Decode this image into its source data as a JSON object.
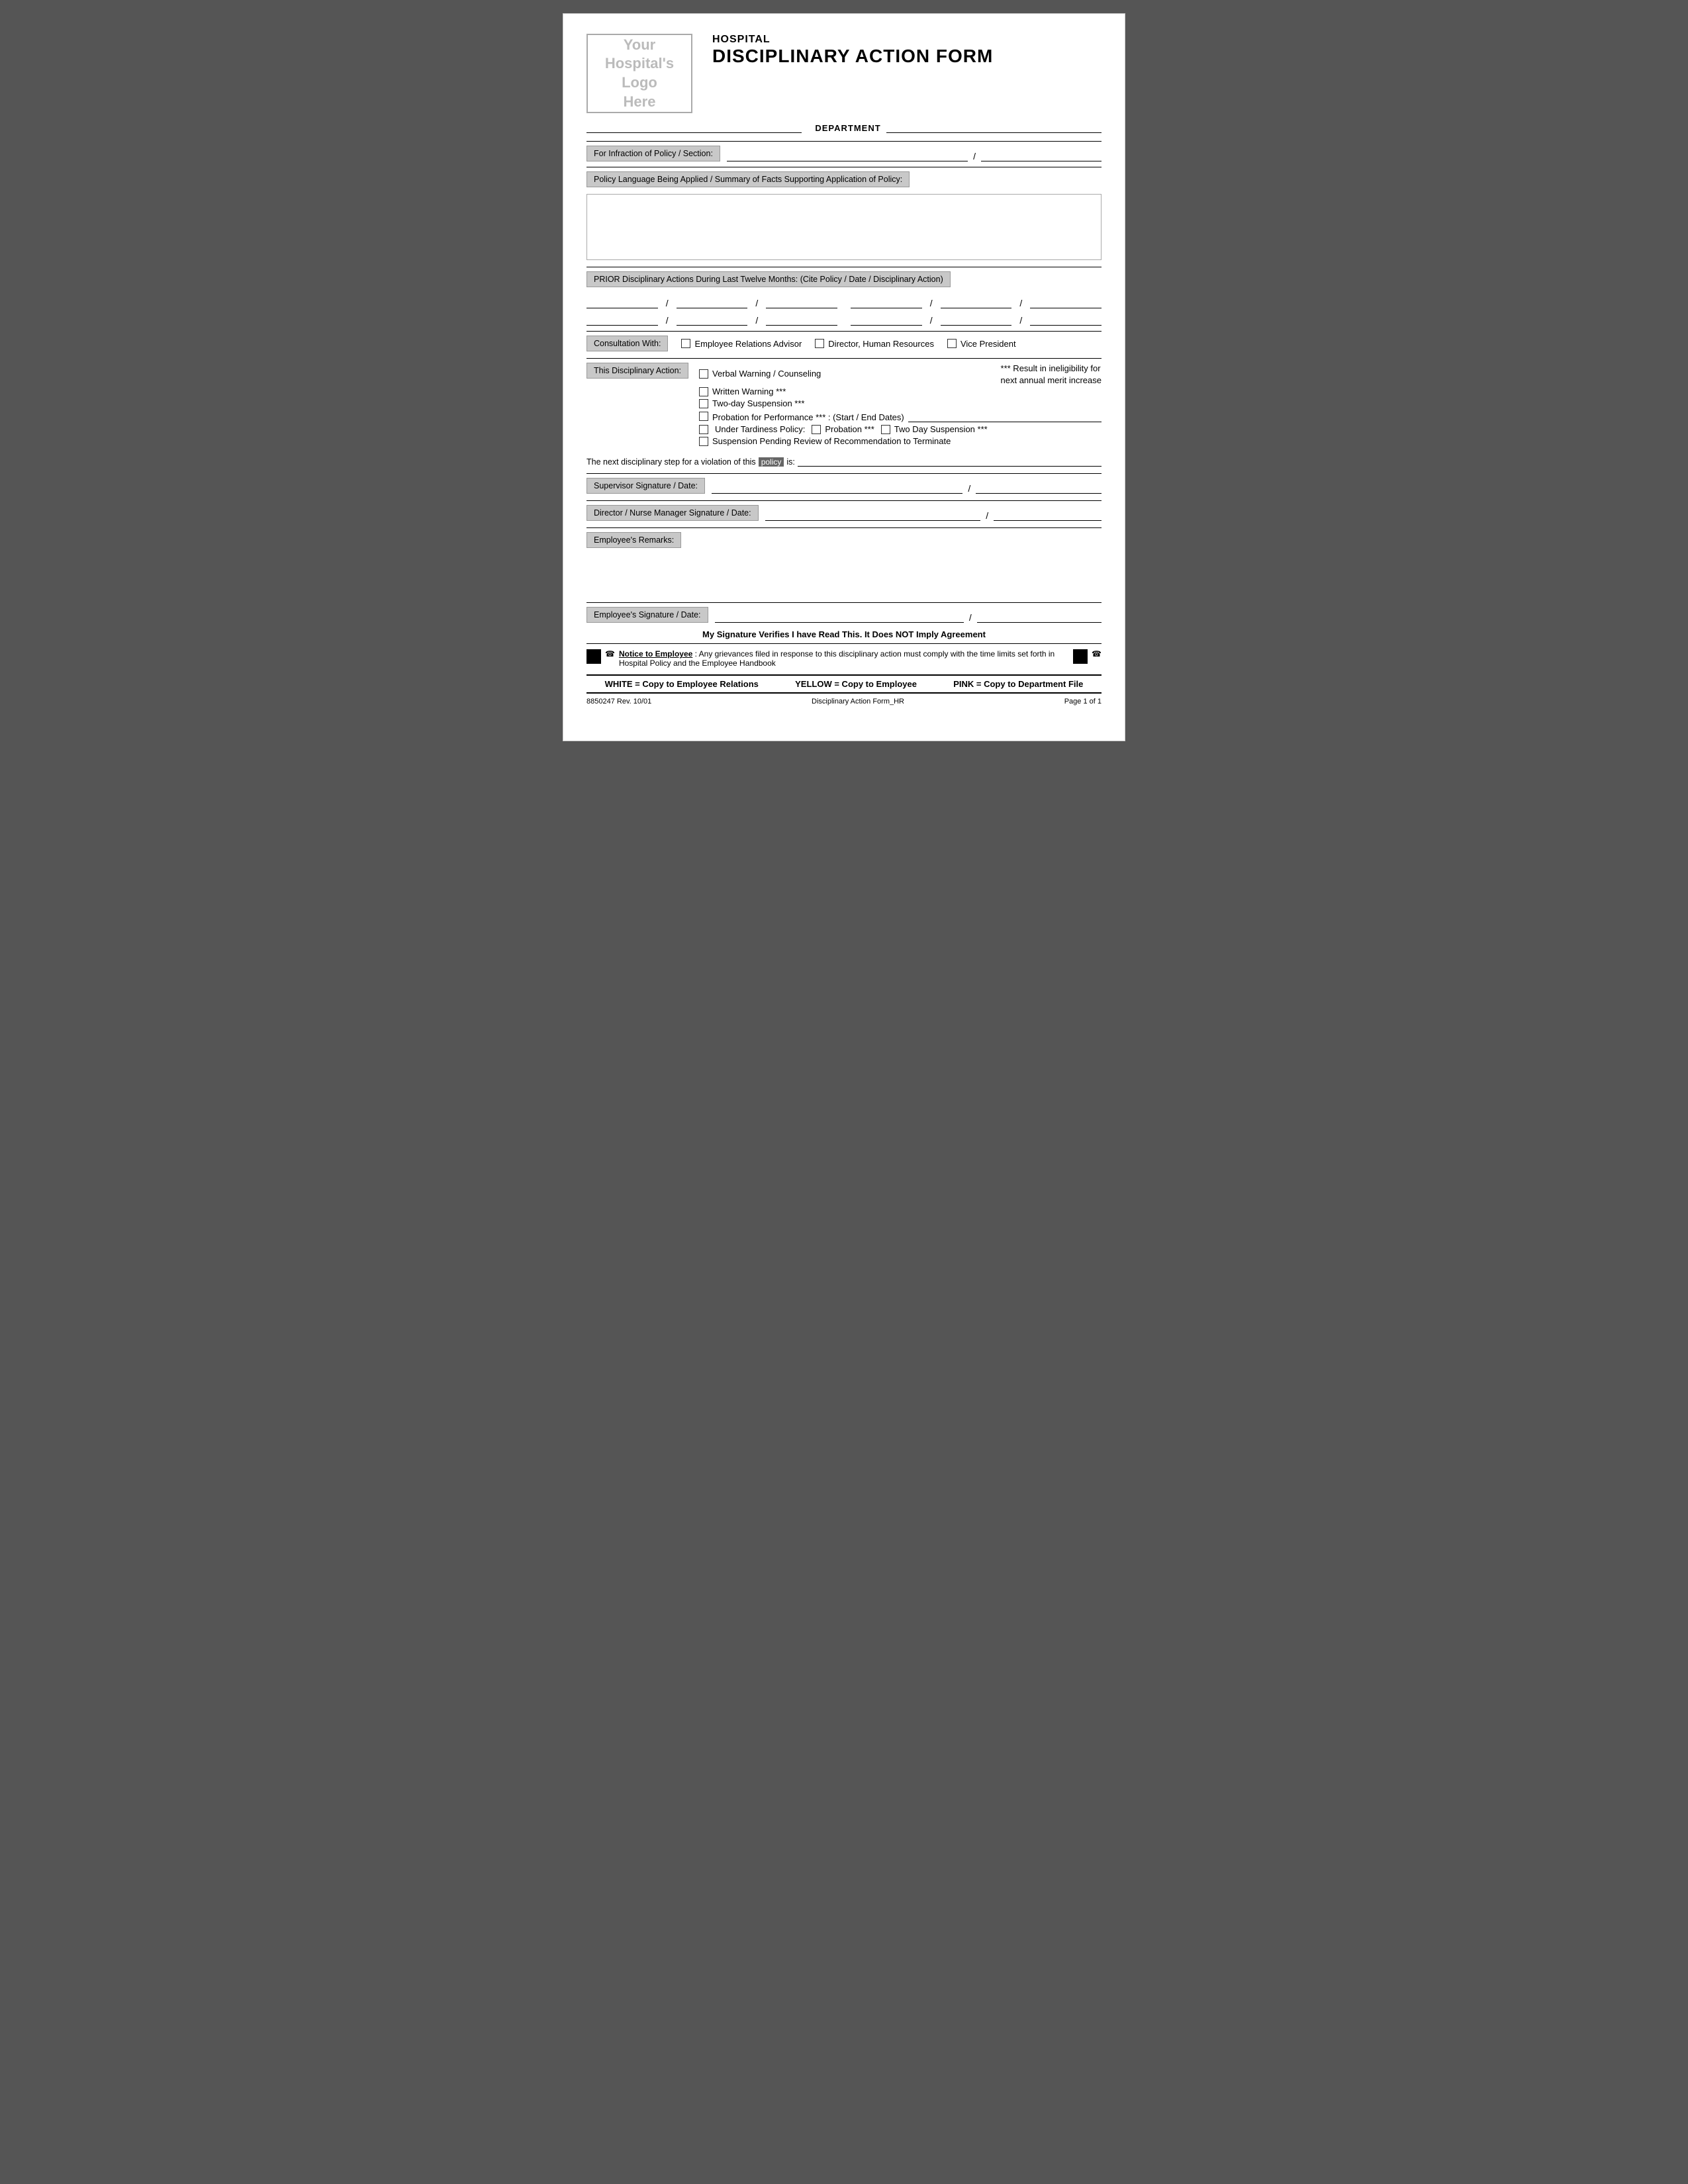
{
  "page": {
    "logo_text": "Your\nHospital's\nLogo\nHere",
    "hospital_label": "HOSPITAL",
    "main_title": "DISCIPLINARY ACTION FORM",
    "dept_label": "DEPARTMENT",
    "infraction_label": "For Infraction of Policy / Section:",
    "policy_label": "Policy Language Being Applied / Summary of Facts Supporting Application of Policy:",
    "prior_label": "PRIOR Disciplinary Actions During Last Twelve Months:   (Cite Policy / Date / Disciplinary Action)",
    "consult_label": "Consultation With:",
    "consult_options": [
      "Employee Relations Advisor",
      "Director, Human Resources",
      "Vice President"
    ],
    "disc_label": "This Disciplinary Action:",
    "disc_options": [
      "Verbal Warning / Counseling",
      "Written Warning ***",
      "Two-day Suspension ***",
      "Probation for Performance *** :  (Start / End Dates)",
      "Under Tardiness Policy:",
      "Suspension Pending Review of Recommendation to Terminate"
    ],
    "tardiness_sub": [
      "Probation ***",
      "Two Day Suspension ***"
    ],
    "result_note_line1": "*** Result in ineligibility for",
    "result_note_line2": "next annual merit increase",
    "next_step_prefix": "The next disciplinary step for a violation of this",
    "next_step_policy": "policy",
    "next_step_suffix": "is:",
    "supervisor_label": "Supervisor Signature / Date:",
    "director_label": "Director / Nurse Manager Signature / Date:",
    "remarks_label": "Employee's Remarks:",
    "emp_sig_label": "Employee's Signature / Date:",
    "sig_verify": "My Signature Verifies I have Read This.  It Does NOT Imply Agreement",
    "notice_label": "Notice to Employee",
    "notice_text": ": Any grievances filed in response to this disciplinary action must comply with the time limits set forth in Hospital Policy and the Employee Handbook",
    "copy_footer": [
      "WHITE = Copy to Employee Relations",
      "YELLOW = Copy to Employee",
      "PINK = Copy to Department File"
    ],
    "footer_left": "8850247  Rev. 10/01",
    "footer_center": "Disciplinary Action Form_HR",
    "footer_right": "Page 1 of 1"
  }
}
